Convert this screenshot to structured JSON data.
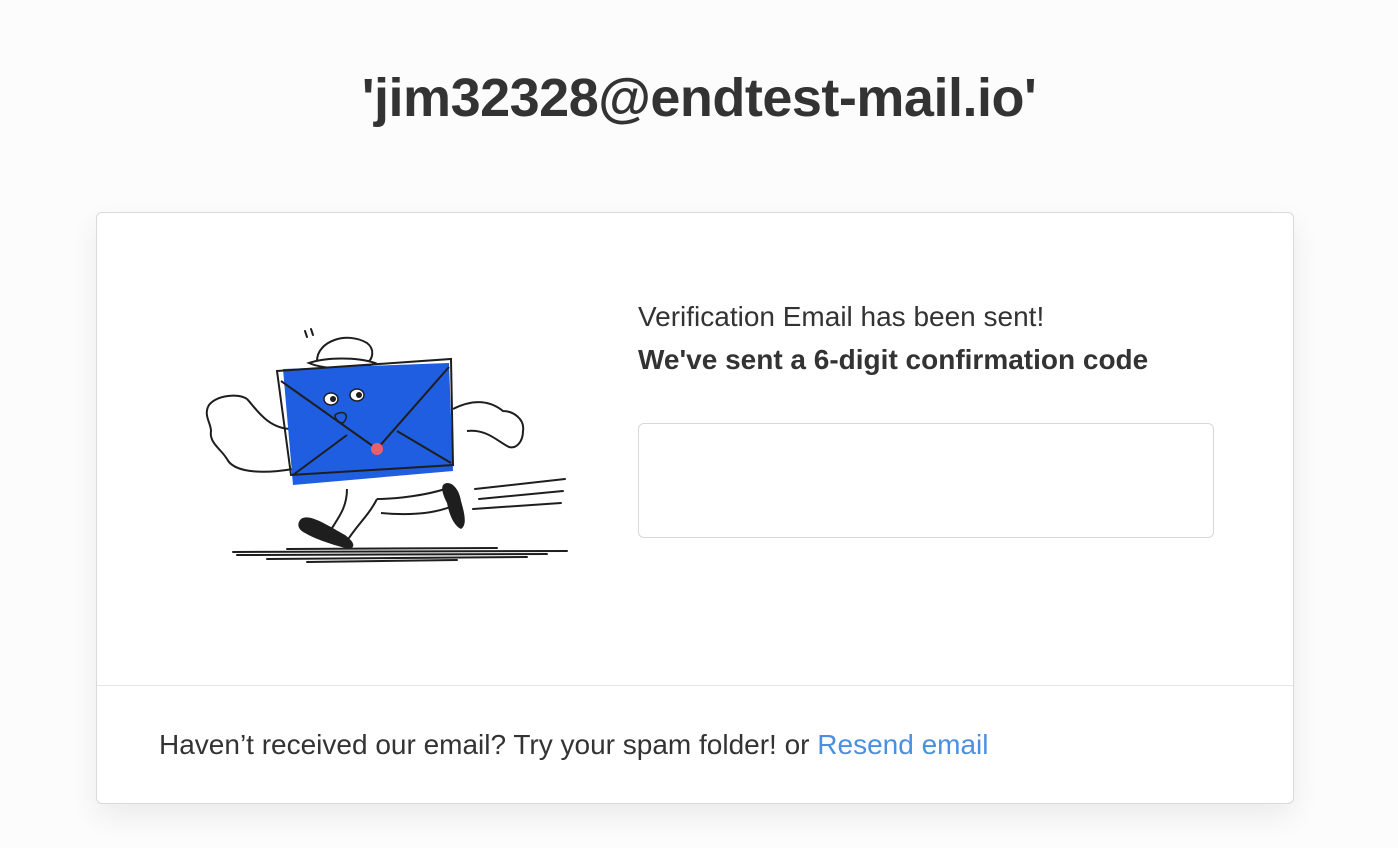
{
  "header": {
    "email": "'jim32328@endtest-mail.io'"
  },
  "verification": {
    "sent_message": "Verification Email has been sent!",
    "code_message": "We've sent a 6-digit confirmation code",
    "code_input_value": "",
    "code_input_placeholder": ""
  },
  "footer": {
    "prompt": "Haven’t received our email? Try your spam folder! or ",
    "resend_label": "Resend email"
  },
  "colors": {
    "envelope": "#1f5ee0",
    "link": "#4a8fe2",
    "text": "#333333",
    "seal": "#e8606e"
  },
  "icons": {
    "illustration": "running-envelope-mascot"
  }
}
